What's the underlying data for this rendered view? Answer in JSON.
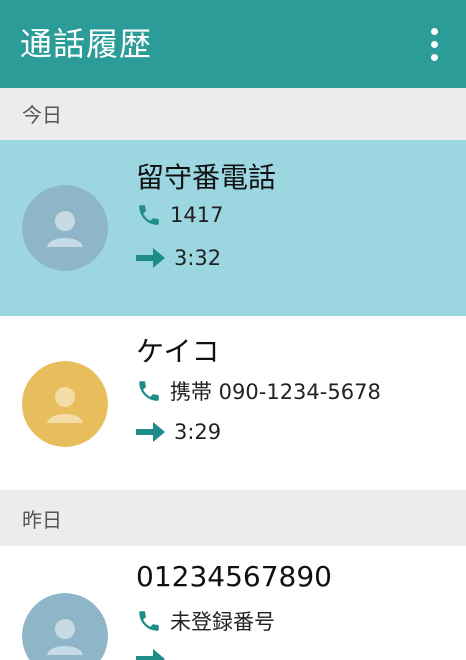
{
  "app_bar": {
    "title": "通話履歴",
    "overflow_icon": "more-vert-icon"
  },
  "colors": {
    "app_bar": "#2b9c98",
    "highlight_row": "#9cd6e1",
    "section_header_bg": "#ececec",
    "accent_icon": "#1e8c88",
    "avatar_blue": "#8fb6c8",
    "avatar_orange": "#e8bd5c"
  },
  "sections": [
    {
      "header": "今日",
      "entries": [
        {
          "name": "留守番電話",
          "number_line": "1417",
          "duration_or_time": "3:32",
          "avatar_icon": "person-icon",
          "avatar_color": "blue",
          "selected": true
        },
        {
          "name": "ケイコ",
          "number_line": "携帯 090-1234-5678",
          "duration_or_time": "3:29",
          "avatar_icon": "person-icon",
          "avatar_color": "orange",
          "selected": false
        }
      ]
    },
    {
      "header": "昨日",
      "entries": [
        {
          "name": "01234567890",
          "number_line": "未登録番号",
          "duration_or_time": "",
          "avatar_icon": "person-icon",
          "avatar_color": "blue",
          "selected": false
        }
      ]
    }
  ]
}
